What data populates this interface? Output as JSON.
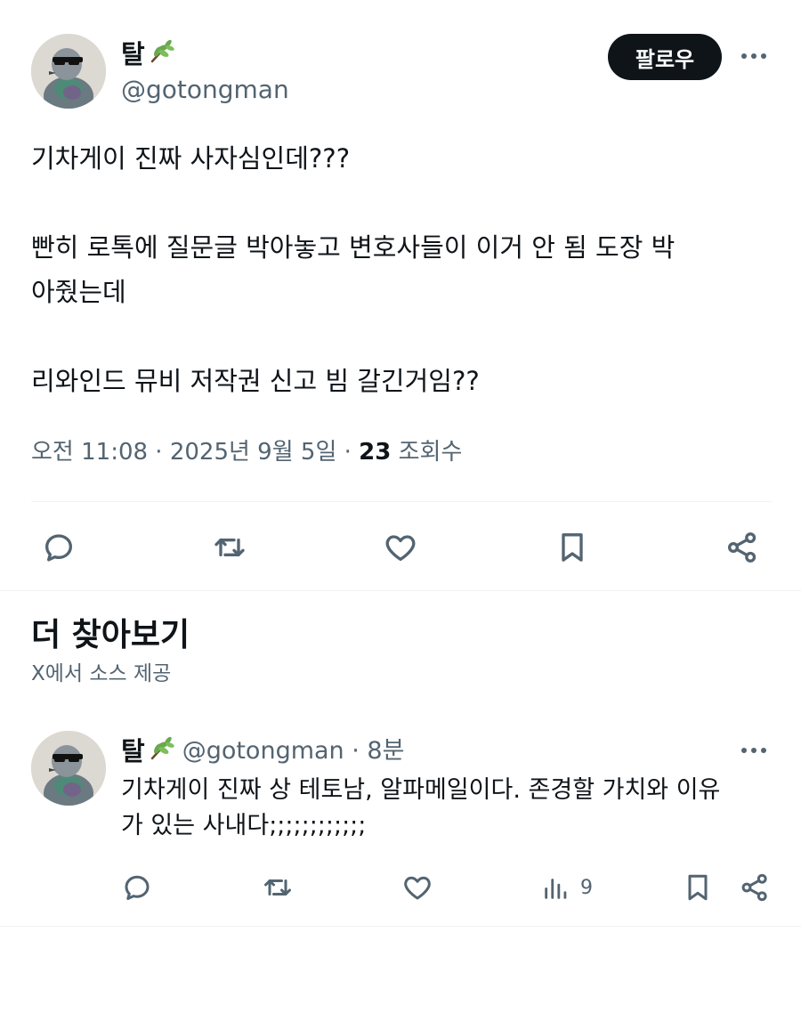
{
  "tweet": {
    "display_name": "탈",
    "name_emoji": "🌿",
    "handle": "@gotongman",
    "follow_label": "팔로우",
    "lines": [
      "기차게이 진짜 사자심인데???",
      "",
      "빤히 로톡에 질문글 박아놓고 변호사들이 이거 안 됨 도장 박",
      "아줬는데",
      "",
      "리와인드 뮤비 저작권 신고 빔 갈긴거임??"
    ],
    "meta_prefix": "오전 11:08 · 2025년 9월 5일 · ",
    "views_count": "23",
    "views_label": " 조회수",
    "action_icons": [
      "reply-icon",
      "retweet-icon",
      "like-icon",
      "bookmark-icon",
      "share-icon"
    ]
  },
  "discover": {
    "title": "더 찾아보기",
    "subtitle": "X에서 소스 제공"
  },
  "reply": {
    "display_name": "탈",
    "name_emoji": "🌿",
    "handle_time": "@gotongman · 8분",
    "line1": "기차게이 진짜 상 테토남, 알파메일이다. 존경할 가치와 이유",
    "line2": "가 있는 사내다;;;;;;;;;;;;",
    "view_count": "9"
  },
  "colors": {
    "text": "#0f1419",
    "secondary": "#536471",
    "divider": "#eff3f4",
    "follow_bg": "#0f1419"
  }
}
